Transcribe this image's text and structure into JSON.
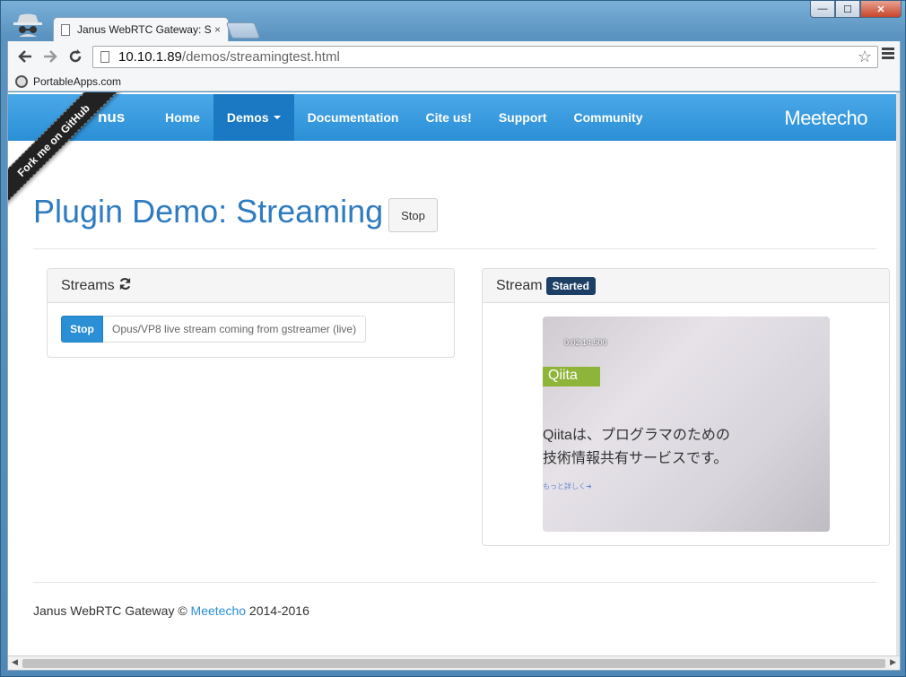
{
  "browser": {
    "tab_title": "Janus WebRTC Gateway: S",
    "tab_close": "×",
    "url_host": "10.10.1.89",
    "url_path": "/demos/streamingtest.html",
    "bookmark_label": "PortableApps.com",
    "back_icon": "back-arrow-icon",
    "forward_icon": "forward-arrow-icon",
    "reload_icon": "reload-icon",
    "minimize": "—",
    "maximize": "☐",
    "close": "✕"
  },
  "navbar": {
    "brand": "nus",
    "items": [
      "Home",
      "Demos",
      "Documentation",
      "Cite us!",
      "Support",
      "Community"
    ],
    "active": "Demos",
    "logo": "Meetecho",
    "ribbon": "Fork me on GitHub"
  },
  "page": {
    "title": "Plugin Demo: Streaming",
    "title_stop_button": "Stop"
  },
  "streams_panel": {
    "heading": "Streams",
    "refresh_icon": "refresh-icon",
    "stop_button": "Stop",
    "stream_label": "Opus/VP8 live stream coming from gstreamer (live)"
  },
  "stream_panel": {
    "heading": "Stream",
    "status_badge": "Started",
    "video": {
      "timestamp": "0:02:14.500",
      "qiita": "Qiita",
      "line1": "Qiitaは、プログラマのための",
      "line2": "技術情報共有サービスです。",
      "link": "もっと詳しく➜"
    }
  },
  "footer": {
    "text_prefix": "Janus WebRTC Gateway © ",
    "link": "Meetecho",
    "text_suffix": " 2014-2016"
  }
}
